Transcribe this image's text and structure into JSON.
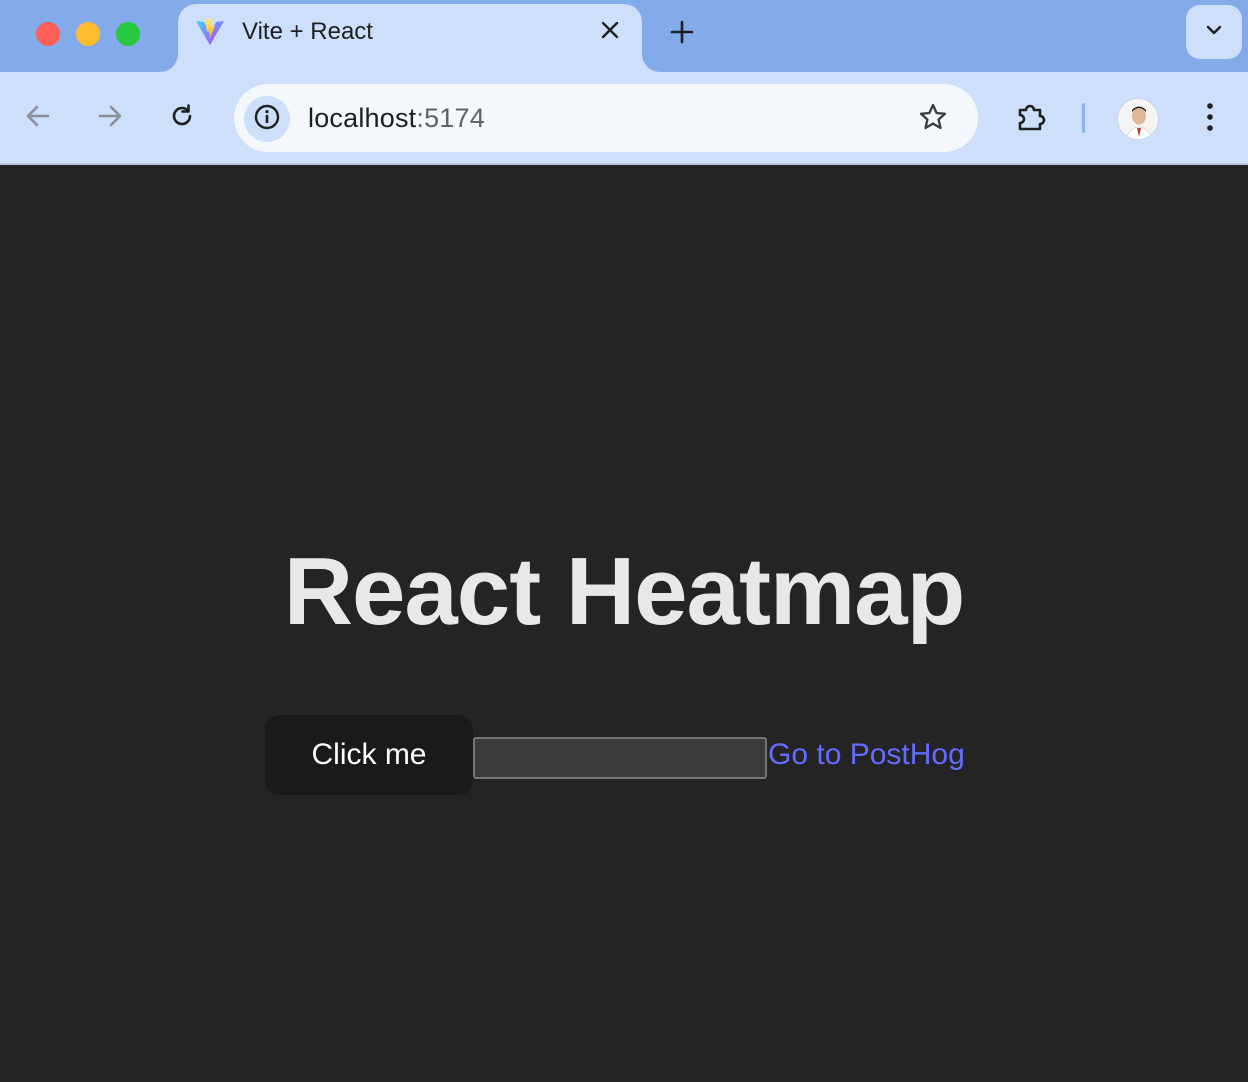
{
  "browser": {
    "tab": {
      "title": "Vite + React",
      "favicon": "vite-logo-icon"
    },
    "address_bar": {
      "host": "localhost",
      "port": ":5174"
    },
    "icons": {
      "back": "back-arrow-icon",
      "forward": "forward-arrow-icon",
      "reload": "reload-icon",
      "site_info": "info-icon",
      "bookmark": "star-icon",
      "extensions": "puzzle-icon",
      "menu": "kebab-menu-icon",
      "tab_search": "chevron-down-icon",
      "new_tab": "plus-icon",
      "close_tab": "close-icon"
    },
    "colors": {
      "tabstrip": "#83aae9",
      "toolbar": "#cddffa"
    }
  },
  "page": {
    "heading": "React Heatmap",
    "button_label": "Click me",
    "input_value": "",
    "link_text": "Go to PostHog",
    "colors": {
      "background": "#242424",
      "link": "#646cff",
      "heading": "#e8e8e8"
    }
  }
}
